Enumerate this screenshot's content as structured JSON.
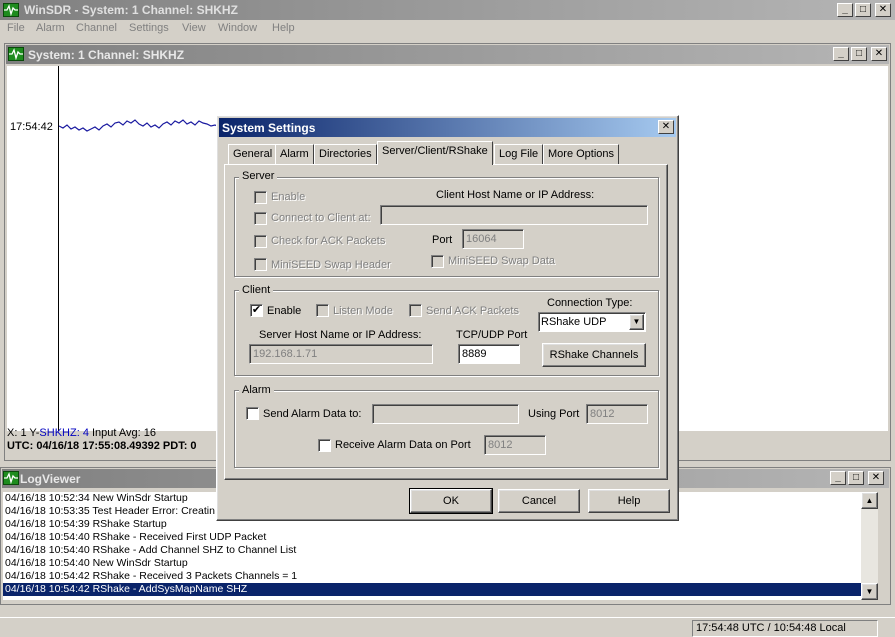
{
  "app": {
    "title": "WinSDR - System: 1 Channel: SHKHZ",
    "menu": [
      "File",
      "Alarm",
      "Channel",
      "Settings",
      "View",
      "Window",
      "Help"
    ]
  },
  "system_window": {
    "title": "System: 1 Channel: SHKHZ",
    "time_label": "17:54:42",
    "status_line1_prefix": "X: 1  Y-",
    "status_line1_channel": "SHKHZ: 4",
    "status_line1_suffix": "  Input Avg: 16",
    "status_line2": "UTC: 04/16/18 17:55:08.49392  PDT: 0"
  },
  "log_viewer": {
    "title": "LogViewer",
    "lines": [
      "04/16/18 10:52:34 New WinSdr Startup",
      "04/16/18 10:53:35 Test Header Error: Creatin",
      "04/16/18 10:54:39 RShake Startup",
      "04/16/18 10:54:40 RShake - Received First UDP Packet",
      "04/16/18 10:54:40 RShake - Add Channel SHZ to Channel List",
      "04/16/18 10:54:40 New WinSdr Startup",
      "04/16/18 10:54:42 RShake - Received 3 Packets Channels = 1",
      "04/16/18 10:54:42 RShake - AddSysMapName SHZ"
    ],
    "selected_index": 7
  },
  "status_bar": {
    "clock": "17:54:48 UTC / 10:54:48 Local"
  },
  "dialog": {
    "title": "System Settings",
    "close_symbol": "✕",
    "tabs": [
      "General",
      "Alarm",
      "Directories",
      "Server/Client/RShake",
      "Log File",
      "More Options"
    ],
    "active_tab_index": 3,
    "server": {
      "group_label": "Server",
      "enable_label": "Enable",
      "connect_label": "Connect to Client at:",
      "host_label": "Client Host Name or IP Address:",
      "host_value": "",
      "ack_label": "Check for ACK Packets",
      "port_label": "Port",
      "port_value": "16064",
      "miniseed_header_label": "MiniSEED Swap Header",
      "miniseed_data_label": "MiniSEED Swap Data"
    },
    "client": {
      "group_label": "Client",
      "enable_label": "Enable",
      "enable_checked": true,
      "listen_label": "Listen Mode",
      "send_ack_label": "Send ACK Packets",
      "connection_type_label": "Connection Type:",
      "connection_type_value": "RShake UDP",
      "server_host_label": "Server Host Name or IP Address:",
      "server_host_value": "192.168.1.71",
      "port_label": "TCP/UDP Port",
      "port_value": "8889",
      "rshake_channels_button": "RShake Channels"
    },
    "alarm": {
      "group_label": "Alarm",
      "send_label": "Send Alarm Data to:",
      "send_value": "",
      "using_port_label": "Using Port",
      "using_port_value": "8012",
      "receive_label": "Receive Alarm Data on Port",
      "receive_port_value": "8012"
    },
    "buttons": {
      "ok": "OK",
      "cancel": "Cancel",
      "help": "Help"
    }
  },
  "check_mark": "✔"
}
